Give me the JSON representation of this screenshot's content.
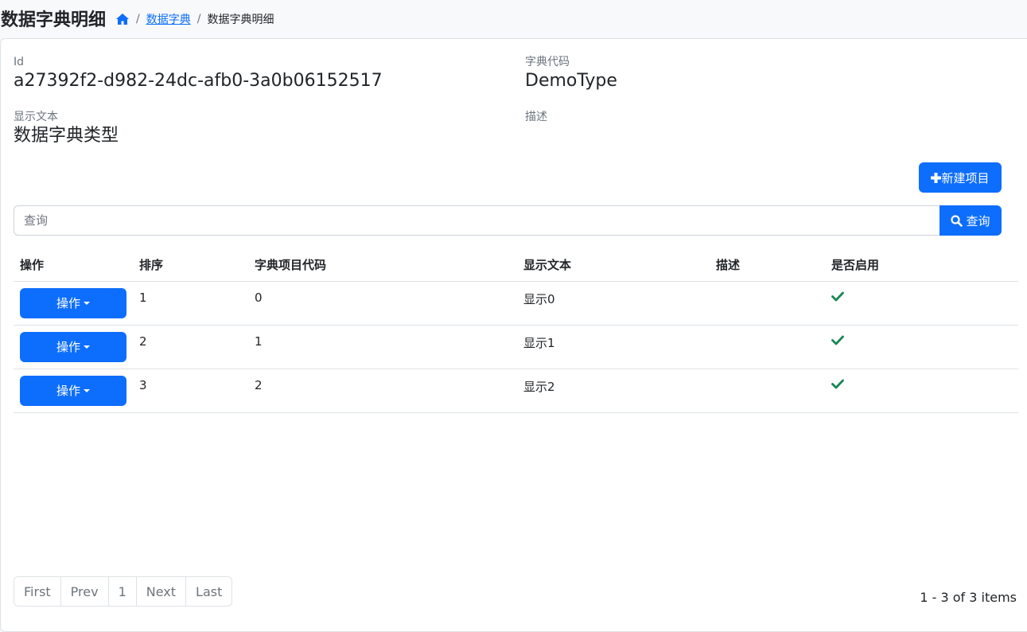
{
  "header": {
    "title": "数据字典明细",
    "breadcrumb": {
      "home_icon": "home-icon",
      "separator": "/",
      "link": "数据字典",
      "current": "数据字典明细"
    }
  },
  "detail": {
    "id_label": "Id",
    "id_value": "a27392f2-d982-24dc-afb0-3a0b06152517",
    "code_label": "字典代码",
    "code_value": "DemoType",
    "text_label": "显示文本",
    "text_value": "数据字典类型",
    "desc_label": "描述",
    "desc_value": ""
  },
  "toolbar": {
    "new_button": "新建项目",
    "new_icon": "plus-icon",
    "search_placeholder": "查询",
    "search_button": "查询",
    "search_icon": "search-icon"
  },
  "table": {
    "columns": [
      "操作",
      "排序",
      "字典项目代码",
      "显示文本",
      "描述",
      "是否启用"
    ],
    "rows": [
      {
        "action": "操作",
        "order": "1",
        "code": "0",
        "text": "显示0",
        "desc": "",
        "enabled": true
      },
      {
        "action": "操作",
        "order": "2",
        "code": "1",
        "text": "显示1",
        "desc": "",
        "enabled": true
      },
      {
        "action": "操作",
        "order": "3",
        "code": "2",
        "text": "显示2",
        "desc": "",
        "enabled": true
      }
    ]
  },
  "pagination": {
    "first": "First",
    "prev": "Prev",
    "page": "1",
    "next": "Next",
    "last": "Last",
    "info": "1 - 3 of 3 items"
  },
  "colors": {
    "primary": "#0d6efd",
    "success": "#198754",
    "muted": "#6c757d"
  }
}
